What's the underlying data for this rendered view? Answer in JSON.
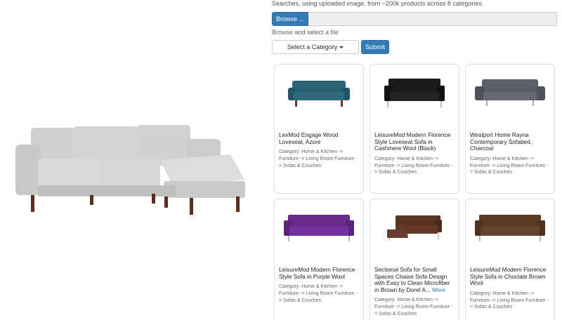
{
  "header": {
    "description": "Searches, using uploaded image, from ~200k products across 8 categories."
  },
  "upload": {
    "browse_label": "Browse ...",
    "file_name": "",
    "helper_text": "Browse and select a file"
  },
  "controls": {
    "category_label": "Select a Category",
    "submit_label": "Submit"
  },
  "query_image": {
    "icon": "sectional-sofa-image",
    "color": "#d7d8d9"
  },
  "results": [
    {
      "title": "LexMod Engage Wood Loveseat, Azure",
      "category": "Category: Home & Kitchen -> Furniture -> Living Room Furniture -> Sofas & Couches",
      "more": "",
      "image": "loveseat-image",
      "color": "#2b6274"
    },
    {
      "title": "LeisureMod Modern Florence Style Loveseat Sofa in Cashmere Wool (Black)",
      "category": "Category: Home & Kitchen -> Furniture -> Living Room Furniture -> Sofas & Couches",
      "more": "",
      "image": "loveseat-image",
      "color": "#1a1a1a"
    },
    {
      "title": "Westport Home Rayna Contemporary Sofabed, Charcoal",
      "category": "Category: Home & Kitchen -> Furniture -> Living Room Furniture -> Sofas & Couches",
      "more": "",
      "image": "sofabed-image",
      "color": "#5c5f68"
    },
    {
      "title": "LeisureMod Modern Florence Style Sofa in Purple Wool",
      "category": "Category: Home & Kitchen -> Furniture -> Living Room Furniture -> Sofas & Couches",
      "more": "",
      "image": "sofa-image",
      "color": "#6a2b8e"
    },
    {
      "title": "Sectional Sofa for Small Spaces Chaise Sofa Design with Easy to Clean Microfiber in Brown by Dorel A...",
      "category": "Category: Home & Kitchen -> Furniture -> Living Room Furniture -> Sofas & Couches",
      "more": "More",
      "image": "sectional-sofa-image",
      "color": "#5a3422"
    },
    {
      "title": "LeisureMod Modern Florence Style Sofa in Choclate Brown Wool",
      "category": "Category: Home & Kitchen -> Furniture -> Living Room Furniture -> Sofas & Couches",
      "more": "",
      "image": "sofa-image",
      "color": "#5b3a26"
    }
  ],
  "theme": {
    "primary": "#337ab7",
    "border": "#dddddd"
  }
}
